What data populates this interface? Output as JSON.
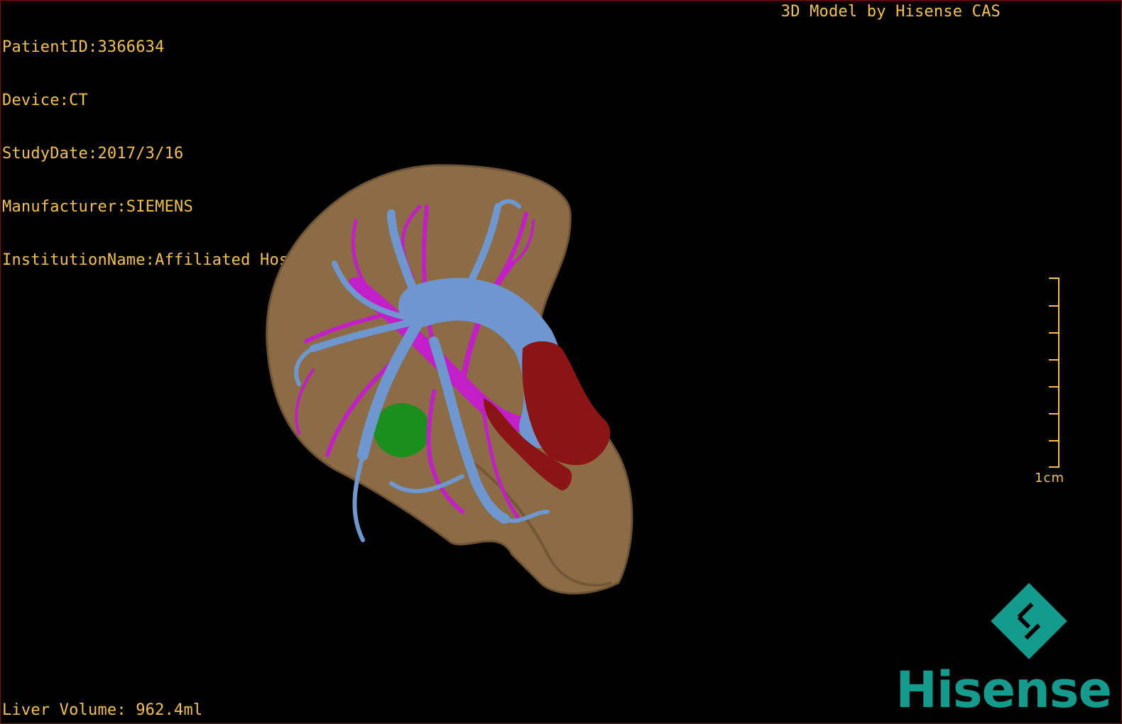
{
  "viewer": {
    "meta": {
      "patient_id": "PatientID:3366634",
      "device": "Device:CT",
      "study_date": "StudyDate:2017/3/16",
      "manufacturer": "Manufacturer:SIEMENS",
      "institution": "InstitutionName:Affiliated Hospital Qingdao University-C"
    },
    "brand_text": "3D Model by Hisense CAS",
    "liver_volume": "Liver Volume: 962.4ml",
    "scale_bar": {
      "label": "1cm",
      "ticks": 7
    },
    "logo_text": "Hisense"
  },
  "colors": {
    "overlay_text": "#f2c24a",
    "liver": "#8b6c45",
    "portal_vein": "#6f97cf",
    "hepatic_artery": "#c21fc9",
    "ivc": "#8b1414",
    "gallbladder": "#1b8f1b",
    "brand": "#149b8e"
  },
  "structures": [
    {
      "name": "liver",
      "icon": "liver-icon"
    },
    {
      "name": "portal vein",
      "icon": "vessel-icon"
    },
    {
      "name": "hepatic artery",
      "icon": "vessel-icon"
    },
    {
      "name": "inferior vena cava",
      "icon": "vessel-icon"
    },
    {
      "name": "gallbladder",
      "icon": "organ-icon"
    }
  ]
}
